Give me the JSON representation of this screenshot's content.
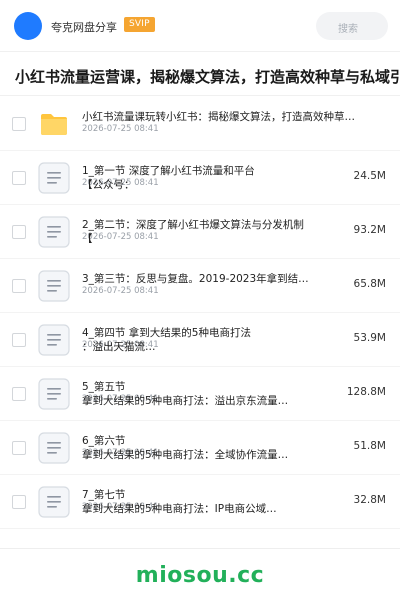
{
  "header": {
    "brand": "夸克网盘分享",
    "badge": "SVIP",
    "search_placeholder": "搜索"
  },
  "share_title": "小红书流量运营课，揭秘爆文算法，打造高效种草与私域引流",
  "files": [
    {
      "name": "小红书流量课玩转小红书：揭秘爆文算法，打造高效种草…",
      "name2": "",
      "date": "2026-07-25 08:41",
      "size": "",
      "icon": "folder-icon"
    },
    {
      "name": "1_第一节 深度了解小红书流量和平台",
      "name2": "【公众号：",
      "date": "2026-07-25 08:41",
      "size": "24.5M",
      "icon": "document-icon"
    },
    {
      "name": "2_第二节：深度了解小红书爆文算法与分发机制",
      "name2": "【",
      "date": "2026-07-25 08:41",
      "size": "93.2M",
      "icon": "document-icon"
    },
    {
      "name": "3_第三节：反思与复盘。2019-2023年拿到结…",
      "name2": "",
      "date": "2026-07-25 08:41",
      "size": "65.8M",
      "icon": "document-icon"
    },
    {
      "name": "4_第四节 拿到大结果的5种电商打法",
      "name2": "：溢出天猫流…",
      "date": "2026-07-25 08:41",
      "size": "53.9M",
      "icon": "document-icon"
    },
    {
      "name": "5_第五节",
      "name2": "拿到大结果的5种电商打法：溢出京东流量…",
      "date": "2026-07-25 08:41",
      "size": "128.8M",
      "icon": "document-icon"
    },
    {
      "name": "6_第六节",
      "name2": "拿到大结果的5种电商打法：全域协作流量…",
      "date": "2026-07-25 08:41",
      "size": "51.8M",
      "icon": "document-icon"
    },
    {
      "name": "7_第七节",
      "name2": "拿到大结果的5种电商打法：IP电商公域…",
      "date": "2026-07-25 08:41",
      "size": "32.8M",
      "icon": "document-icon"
    }
  ],
  "watermark": "miosou.cc"
}
